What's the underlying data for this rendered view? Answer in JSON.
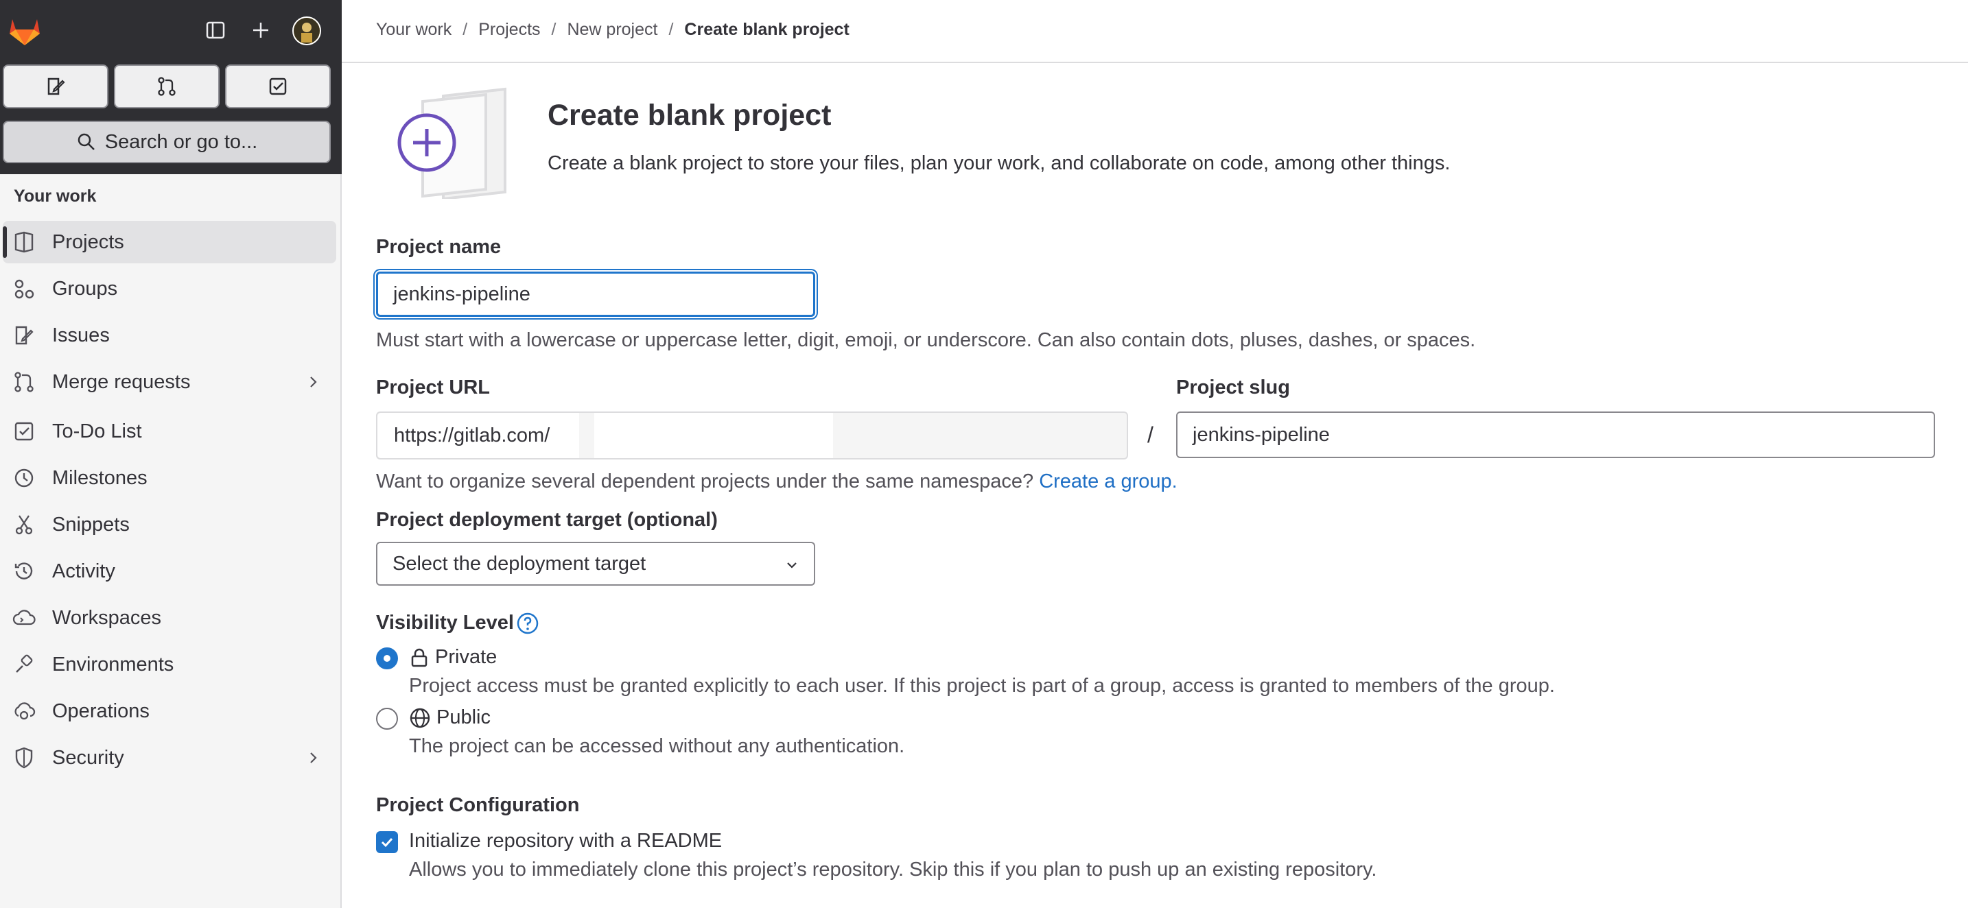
{
  "sidebar": {
    "search_label": "Search or go to...",
    "section_label": "Your work",
    "items": [
      {
        "label": "Projects",
        "icon": "project-icon"
      },
      {
        "label": "Groups",
        "icon": "group-icon"
      },
      {
        "label": "Issues",
        "icon": "issues-icon"
      },
      {
        "label": "Merge requests",
        "icon": "merge-request-icon"
      },
      {
        "label": "To-Do List",
        "icon": "todo-icon"
      },
      {
        "label": "Milestones",
        "icon": "milestone-icon"
      },
      {
        "label": "Snippets",
        "icon": "snippet-icon"
      },
      {
        "label": "Activity",
        "icon": "history-icon"
      },
      {
        "label": "Workspaces",
        "icon": "cloud-terminal-icon"
      },
      {
        "label": "Environments",
        "icon": "environment-icon"
      },
      {
        "label": "Operations",
        "icon": "deployments-icon"
      },
      {
        "label": "Security",
        "icon": "shield-icon"
      }
    ]
  },
  "breadcrumb": {
    "items": [
      "Your work",
      "Projects",
      "New project",
      "Create blank project"
    ]
  },
  "header": {
    "title": "Create blank project",
    "description": "Create a blank project to store your files, plan your work, and collaborate on code, among other things."
  },
  "form": {
    "project_name_label": "Project name",
    "project_name_value": "jenkins-pipeline",
    "project_name_help": "Must start with a lowercase or uppercase letter, digit, emoji, or underscore. Can also contain dots, pluses, dashes, or spaces.",
    "project_url_label": "Project URL",
    "project_url_prefix": "https://gitlab.com/",
    "slash": "/",
    "project_slug_label": "Project slug",
    "project_slug_value": "jenkins-pipeline",
    "namespace_help": "Want to organize several dependent projects under the same namespace?",
    "create_group_link": "Create a group.",
    "deployment_label": "Project deployment target (optional)",
    "deployment_value": "Select the deployment target",
    "visibility_label": "Visibility Level",
    "visibility_options": [
      {
        "title": "Private",
        "desc": "Project access must be granted explicitly to each user. If this project is part of a group, access is granted to members of the group.",
        "selected": true
      },
      {
        "title": "Public",
        "desc": "The project can be accessed without any authentication.",
        "selected": false
      }
    ],
    "configuration_label": "Project Configuration",
    "readme_label": "Initialize repository with a README",
    "readme_desc": "Allows you to immediately clone this project’s repository. Skip this if you plan to push up an existing repository.",
    "readme_checked": true
  },
  "colors": {
    "accent": "#1f75cb",
    "sidebar_top": "#2f2f33",
    "hero_purple": "#6b4fbb"
  }
}
